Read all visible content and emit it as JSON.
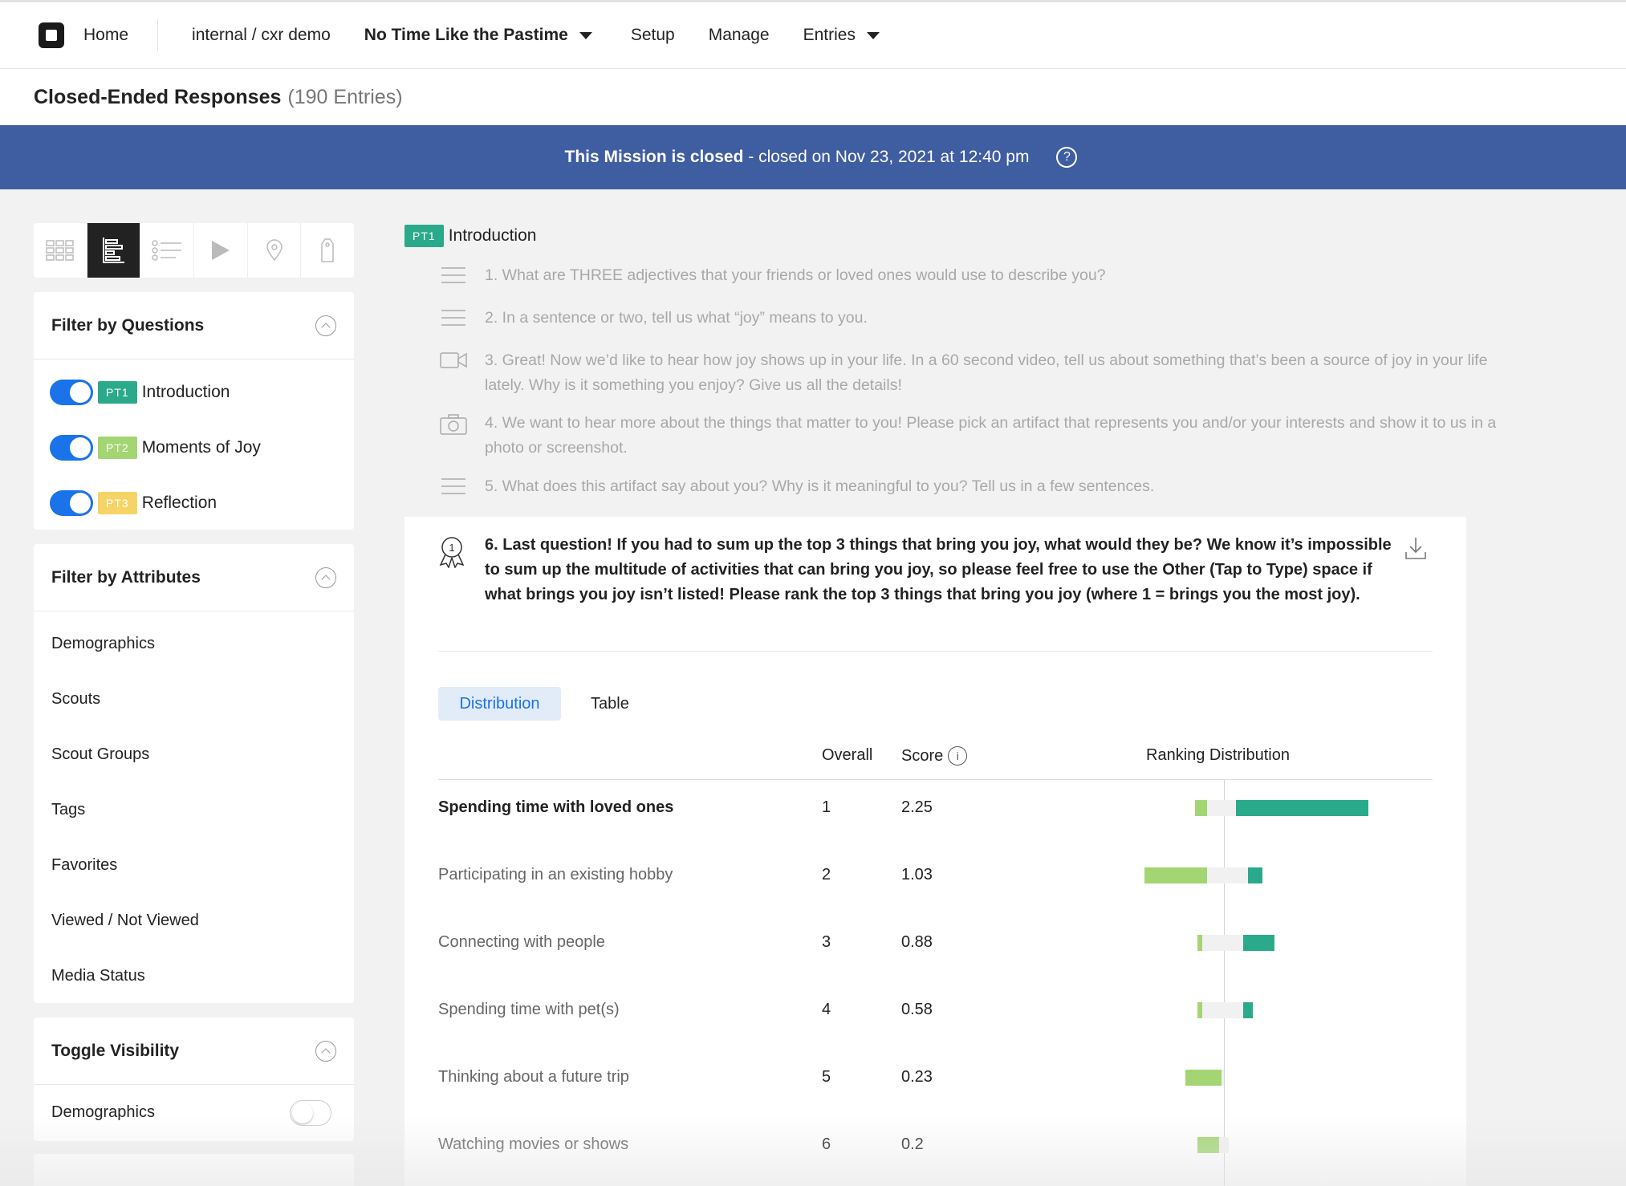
{
  "nav": {
    "home": "Home",
    "workspace": "internal / cxr demo",
    "mission": "No Time Like the Pastime",
    "setup": "Setup",
    "manage": "Manage",
    "entries": "Entries"
  },
  "page": {
    "title": "Closed-Ended Responses",
    "count": "(190 Entries)"
  },
  "banner": {
    "status": "This Mission is closed",
    "detail": " - closed on Nov 23, 2021 at 12:40 pm",
    "help": "?"
  },
  "colors": {
    "pt1": "#2aaa8a",
    "pt2": "#a3d672",
    "pt3": "#f6d365",
    "banner": "#3f5da1",
    "accent": "#1a73e8",
    "bar_positive": "#2aaa8a",
    "bar_negative": "#a3d672"
  },
  "filter_questions": {
    "heading": "Filter by Questions",
    "items": [
      {
        "badge": "PT1",
        "label": "Introduction",
        "on": true
      },
      {
        "badge": "PT2",
        "label": "Moments of Joy",
        "on": true
      },
      {
        "badge": "PT3",
        "label": "Reflection",
        "on": true
      }
    ]
  },
  "filter_attributes": {
    "heading": "Filter by Attributes",
    "items": [
      "Demographics",
      "Scouts",
      "Scout Groups",
      "Tags",
      "Favorites",
      "Viewed / Not Viewed",
      "Media Status"
    ]
  },
  "toggle_visibility": {
    "heading": "Toggle Visibility",
    "items": [
      {
        "label": "Demographics",
        "on": false
      }
    ]
  },
  "section": {
    "badge": "PT1",
    "label": "Introduction"
  },
  "questions": [
    {
      "icon": "text-lines-icon",
      "text": "1. What are THREE adjectives that your friends or loved ones would use to describe you?"
    },
    {
      "icon": "text-lines-icon",
      "text": "2. In a sentence or two, tell us what “joy” means to you."
    },
    {
      "icon": "video-icon",
      "text": "3. Great! Now we’d like to hear how joy shows up in your life. In a 60 second video, tell us about something that’s been a source of joy in your life lately. Why is it something you enjoy? Give us all the details!"
    },
    {
      "icon": "camera-icon",
      "text": "4. We want to hear more about the things that matter to you! Please pick an artifact that represents you and/or your interests and show it to us in a photo or screenshot."
    },
    {
      "icon": "text-lines-icon",
      "text": "5. What does this artifact say about you? Why is it meaningful to you? Tell us in a few sentences."
    }
  ],
  "active_question": {
    "text": "6. Last question! If you had to sum up the top 3 things that bring you joy, what would they be? We know it’s impossible to sum up the multitude of activities that can bring you joy, so please feel free to use the Other (Tap to Type) space if what brings you joy isn’t listed! Please rank the top 3 things that bring you joy (where 1 = brings you the most joy)."
  },
  "tabs": {
    "distribution": "Distribution",
    "table": "Table"
  },
  "table": {
    "col_overall": "Overall",
    "col_score": "Score",
    "col_distribution": "Ranking Distribution",
    "rows": [
      {
        "name": "Spending time with loved ones",
        "rank": "1",
        "score": "2.25",
        "neg": 0.05,
        "neg_light": 0.07,
        "pos": 0.55,
        "pos_gap": 0.05
      },
      {
        "name": "Participating in an existing hobby",
        "rank": "2",
        "score": "1.03",
        "neg": 0.26,
        "neg_light": 0.07,
        "pos": 0.06,
        "pos_gap": 0.1
      },
      {
        "name": "Connecting with people",
        "rank": "3",
        "score": "0.88",
        "neg": 0.02,
        "neg_light": 0.09,
        "pos": 0.13,
        "pos_gap": 0.08
      },
      {
        "name": "Spending time with pet(s)",
        "rank": "4",
        "score": "0.58",
        "neg": 0.02,
        "neg_light": 0.09,
        "pos": 0.04,
        "pos_gap": 0.08
      },
      {
        "name": "Thinking about a future trip",
        "rank": "5",
        "score": "0.23",
        "neg": 0.15,
        "neg_light": 0.01,
        "pos": 0,
        "pos_gap": 0
      },
      {
        "name": "Watching movies or shows",
        "rank": "6",
        "score": "0.2",
        "neg": 0.09,
        "neg_light": 0.02,
        "pos": 0,
        "pos_gap": 0.02
      }
    ]
  }
}
